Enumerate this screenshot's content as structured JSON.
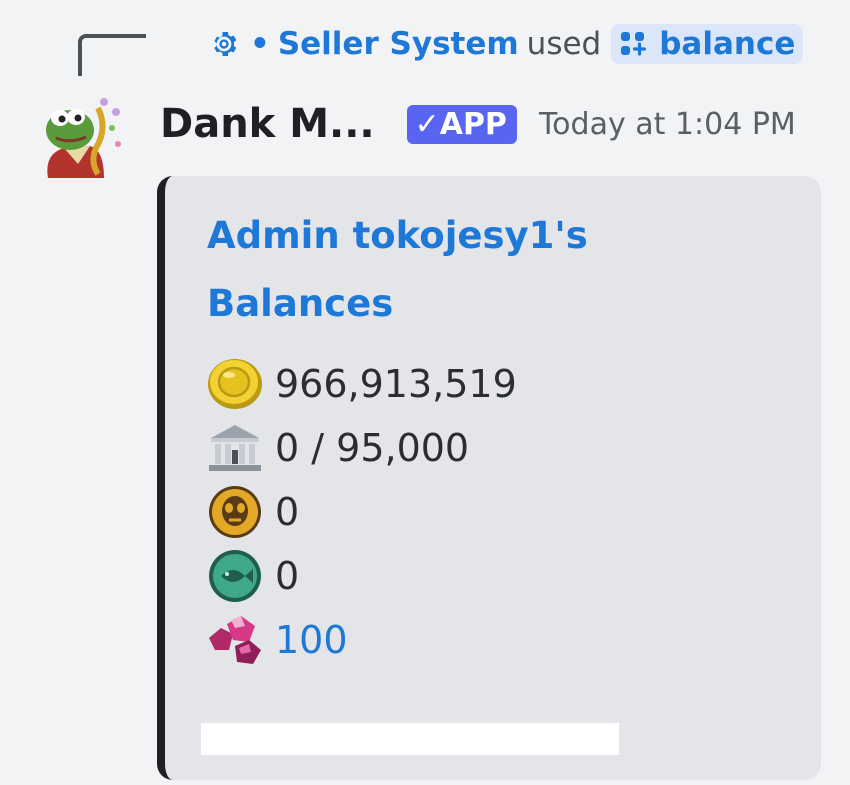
{
  "reply": {
    "user_name": "Seller System",
    "separator": "•",
    "used_text": "used",
    "command": "balance",
    "gear_icon": "gear-icon",
    "command_icon": "slash-command-icon"
  },
  "message": {
    "author": "Dank M...",
    "badge": "✓APP",
    "timestamp": "Today at 1:04 PM",
    "avatar_icon": "pepe-avatar"
  },
  "embed": {
    "title_line1": "Admin tokojesy1's",
    "title_line2": "Balances",
    "rows": [
      {
        "icon": "coin-icon",
        "value": "966,913,519"
      },
      {
        "icon": "bank-icon",
        "value": "0 / 95,000"
      },
      {
        "icon": "skull-coin-icon",
        "value": "0"
      },
      {
        "icon": "fish-coin-icon",
        "value": "0"
      },
      {
        "icon": "gem-icon",
        "value": "100"
      }
    ]
  },
  "colors": {
    "link_blue": "#1e78d8",
    "app_badge": "#5865f2",
    "embed_bg": "#e3e5e8",
    "embed_border": "#1f2024"
  }
}
